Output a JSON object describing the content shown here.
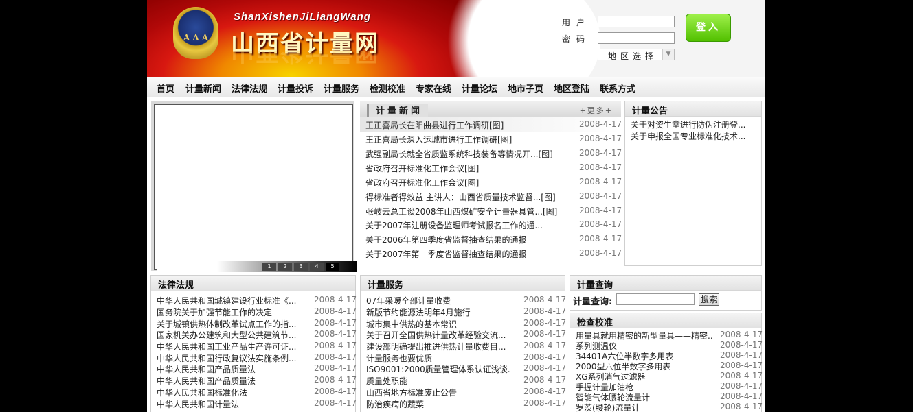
{
  "header": {
    "logo_pinyin": "ShanXishenJiLiangWang",
    "logo_title": "山西省计量网",
    "emblem_text": "A Δ A",
    "user_label": "用户",
    "password_label": "密码",
    "region_select": "地区选择",
    "login_button": "登入"
  },
  "nav": [
    "首页",
    "计量新闻",
    "法律法规",
    "计量投诉",
    "计量服务",
    "检测校准",
    "专家在线",
    "计量论坛",
    "地市子页",
    "地区登陆",
    "联系方式"
  ],
  "slideshow": {
    "pages": [
      "1",
      "2",
      "3",
      "4",
      "5"
    ],
    "active_page": "5"
  },
  "news": {
    "title": "计量新闻",
    "more": "+更多+",
    "items": [
      {
        "title": "王正喜局长在阳曲县进行工作调研[图]",
        "date": "2008-4-17"
      },
      {
        "title": "王正喜局长深入运城市进行工作调研[图]",
        "date": "2008-4-17"
      },
      {
        "title": "武强副局长就全省质监系统科技装备等情况开...[图]",
        "date": "2008-4-17"
      },
      {
        "title": "省政府召开标准化工作会议[图]",
        "date": "2008-4-17"
      },
      {
        "title": "省政府召开标准化工作会议[图]",
        "date": "2008-4-17"
      },
      {
        "title": "得标准者得效益 主讲人：山西省质量技术监督...[图]",
        "date": "2008-4-17"
      },
      {
        "title": "张岐云总工谈2008年山西煤矿安全计量器具管...[图]",
        "date": "2008-4-17"
      },
      {
        "title": "关于2007年注册设备监理师考试报名工作的通...",
        "date": "2008-4-17"
      },
      {
        "title": "关于2006年第四季度省监督抽查结果的通报",
        "date": "2008-4-17"
      },
      {
        "title": "关于2007年第一季度省监督抽查结果的通报",
        "date": "2008-4-17"
      }
    ]
  },
  "notice": {
    "title": "计量公告",
    "items": [
      "关于对资生堂进行防伪注册登...",
      "关于申报全国专业标准化技术..."
    ]
  },
  "law": {
    "title": "法律法规",
    "items": [
      {
        "title": "中华人民共和国城镇建设行业标准《...",
        "date": "2008-4-17"
      },
      {
        "title": "国务院关于加强节能工作的决定",
        "date": "2008-4-17"
      },
      {
        "title": "关于城镇供热体制改革试点工作的指...",
        "date": "2008-4-17"
      },
      {
        "title": "国家机关办公建筑和大型公共建筑节...",
        "date": "2008-4-17"
      },
      {
        "title": "中华人民共和国工业产品生产许可证...",
        "date": "2008-4-17"
      },
      {
        "title": "中华人民共和国行政复议法实施条例...",
        "date": "2008-4-17"
      },
      {
        "title": "中华人民共和国产品质量法",
        "date": "2008-4-17"
      },
      {
        "title": "中华人民共和国产品质量法",
        "date": "2008-4-17"
      },
      {
        "title": "中华人民共和国标准化法",
        "date": "2008-4-17"
      },
      {
        "title": "中华人民共和国计量法",
        "date": "2008-4-17"
      }
    ]
  },
  "service": {
    "title": "计量服务",
    "items": [
      {
        "title": "07年采暖全部计量收费",
        "date": "2008-4-17"
      },
      {
        "title": "新版节约能源法明年4月施行",
        "date": "2008-4-17"
      },
      {
        "title": "城市集中供热的基本常识",
        "date": "2008-4-17"
      },
      {
        "title": "关于召开全国供热计量改革经验交流...",
        "date": "2008-4-17"
      },
      {
        "title": "建设部明确提出推进供热计量收费目...",
        "date": "2008-4-17"
      },
      {
        "title": "计量服务也要优质",
        "date": "2008-4-17"
      },
      {
        "title": "ISO9001:2000质量管理体系认证浅谈...",
        "date": "2008-4-17"
      },
      {
        "title": "质量处职能",
        "date": "2008-4-17"
      },
      {
        "title": "山西省地方标准废止公告",
        "date": "2008-4-17"
      },
      {
        "title": "防治疾病的蔬菜",
        "date": "2008-4-17"
      }
    ]
  },
  "query": {
    "title": "计量查询",
    "label": "计量查询:",
    "button": "搜索"
  },
  "check": {
    "title": "检查校准",
    "items": [
      {
        "title": "用量具就用精密的新型量具——精密...",
        "date": "2008-4-17"
      },
      {
        "title": "系列测温仪",
        "date": "2008-4-17"
      },
      {
        "title": "34401A六位半数字多用表",
        "date": "2008-4-17"
      },
      {
        "title": "2000型六位半数字多用表",
        "date": "2008-4-17"
      },
      {
        "title": "XG系列消气过滤器",
        "date": "2008-4-17"
      },
      {
        "title": "手握计量加油枪",
        "date": "2008-4-17"
      },
      {
        "title": "智能气体腰轮流量计",
        "date": "2008-4-17"
      },
      {
        "title": "罗茨(腰轮)流量计",
        "date": "2008-4-17"
      }
    ]
  }
}
